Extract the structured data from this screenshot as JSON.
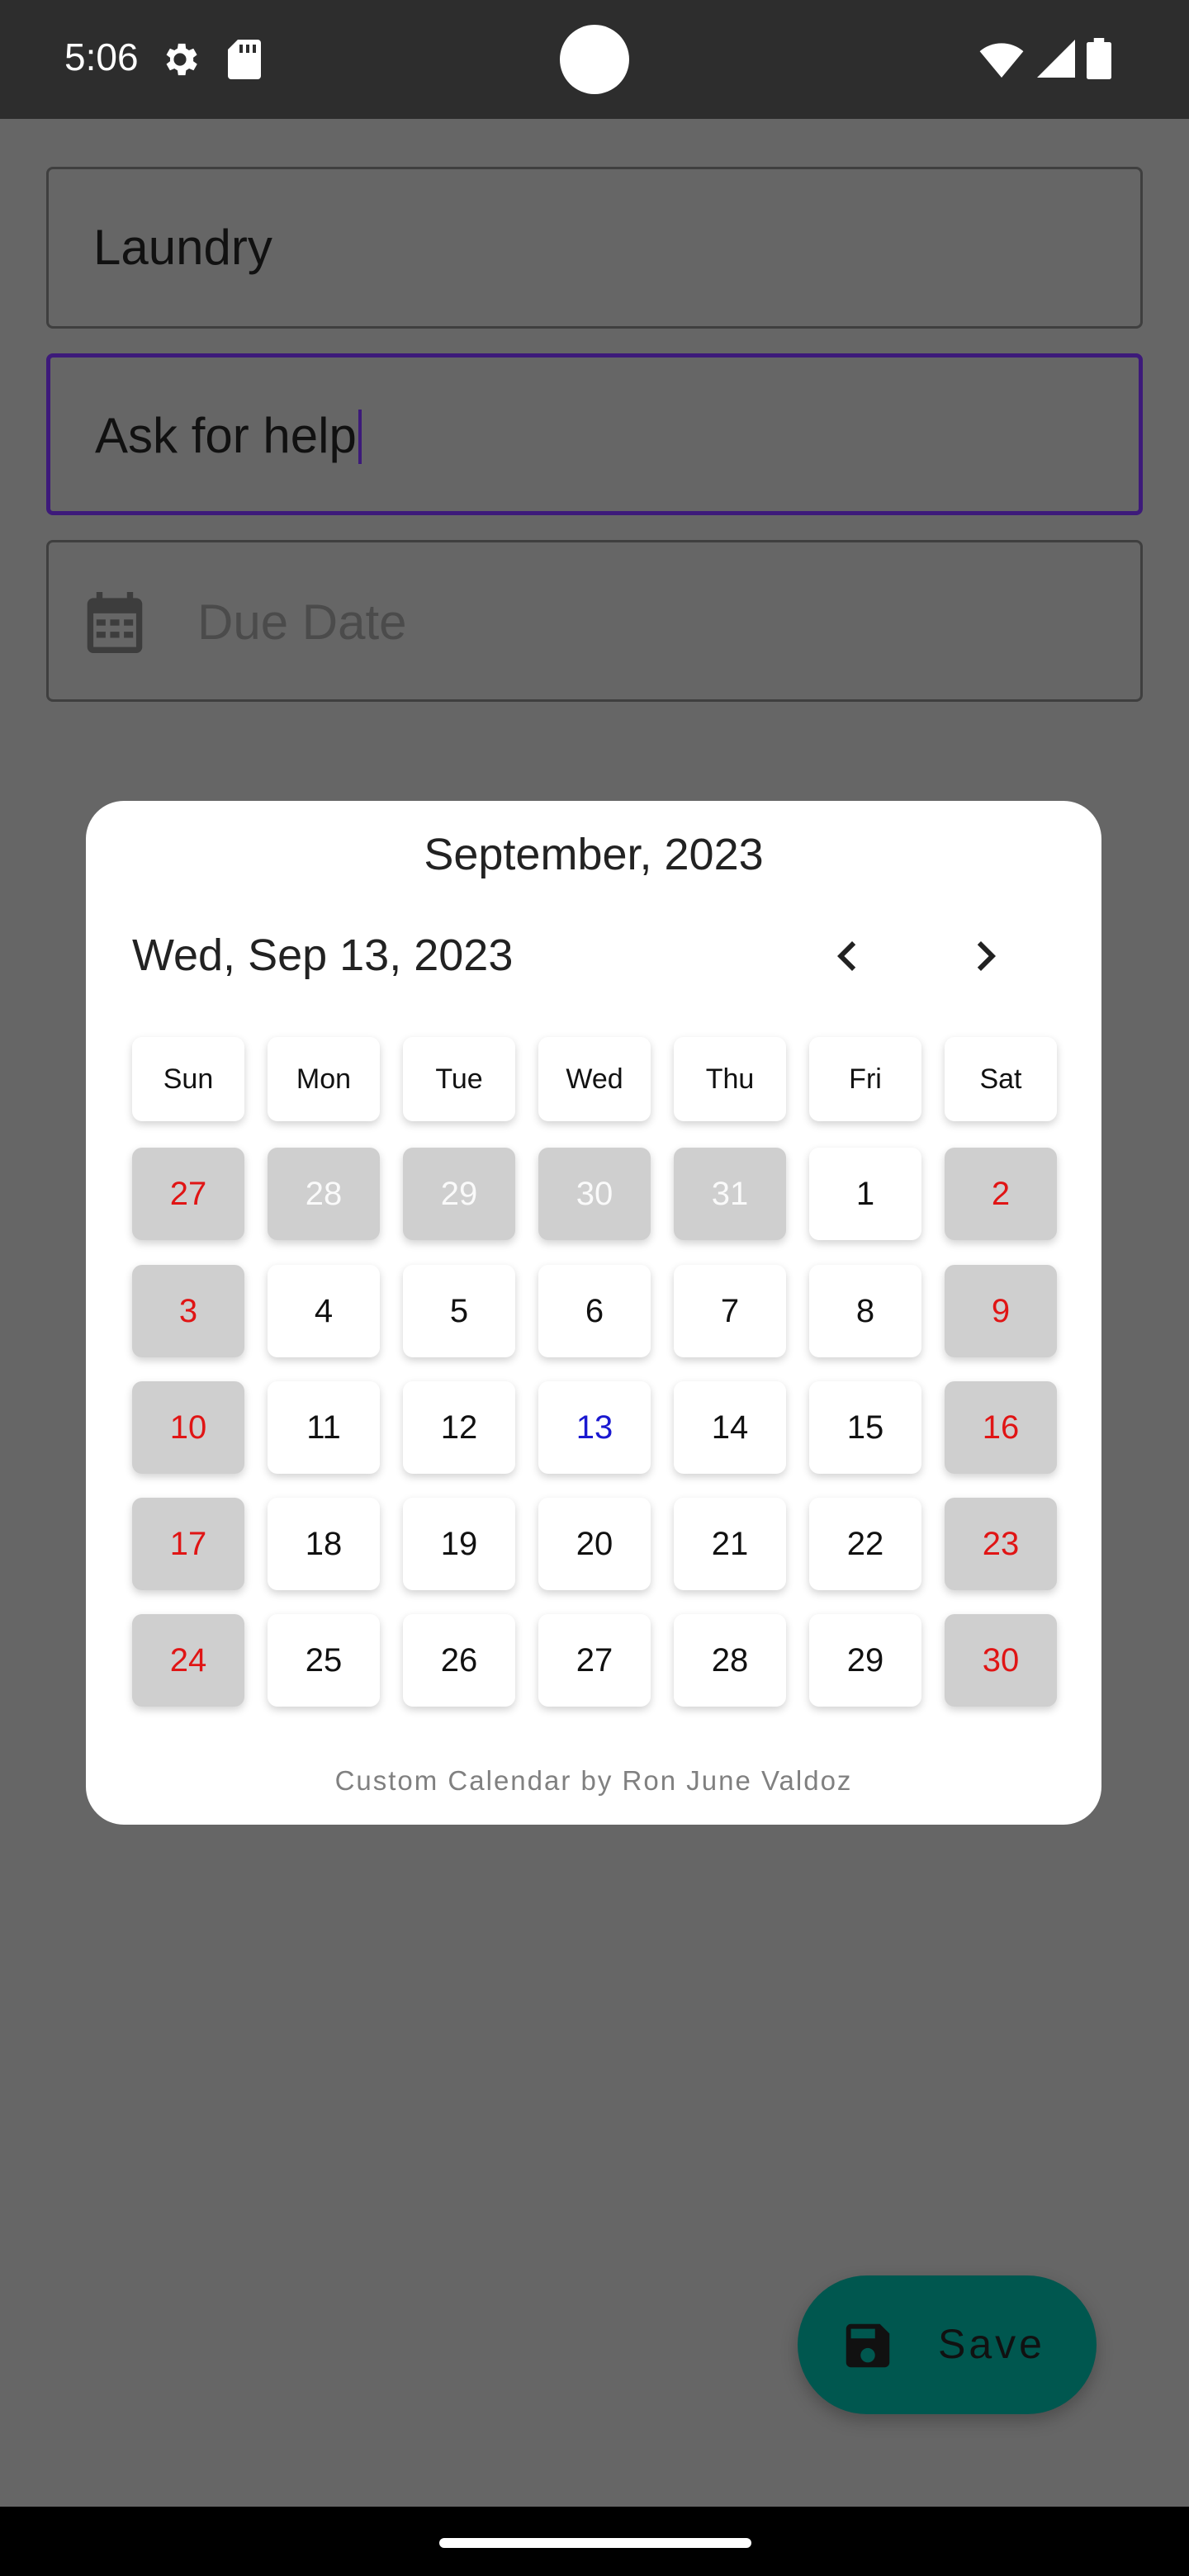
{
  "status_bar": {
    "time": "5:06",
    "icons": [
      "gear-icon",
      "sd-card-icon",
      "wifi-icon",
      "signal-icon",
      "battery-icon"
    ]
  },
  "form": {
    "title_value": "Laundry",
    "description_value": "Ask for help",
    "due_date_placeholder": "Due Date",
    "focus_color": "#3d1a7a"
  },
  "calendar": {
    "month_title": "September, 2023",
    "selected_date": "Wed, Sep 13, 2023",
    "weekdays": [
      "Sun",
      "Mon",
      "Tue",
      "Wed",
      "Thu",
      "Fri",
      "Sat"
    ],
    "weeks": [
      [
        "27",
        "28",
        "29",
        "30",
        "31",
        "1",
        "2"
      ],
      [
        "3",
        "4",
        "5",
        "6",
        "7",
        "8",
        "9"
      ],
      [
        "10",
        "11",
        "12",
        "13",
        "14",
        "15",
        "16"
      ],
      [
        "17",
        "18",
        "19",
        "20",
        "21",
        "22",
        "23"
      ],
      [
        "24",
        "25",
        "26",
        "27",
        "28",
        "29",
        "30"
      ]
    ],
    "today": "13",
    "colors": {
      "weekend_text": "#e01515",
      "today_text": "#1a18d0",
      "muted_bg": "#cfcfcf"
    },
    "credit": "Custom Calendar by Ron June Valdoz"
  },
  "fab": {
    "label": "Save",
    "color": "#00574f"
  }
}
